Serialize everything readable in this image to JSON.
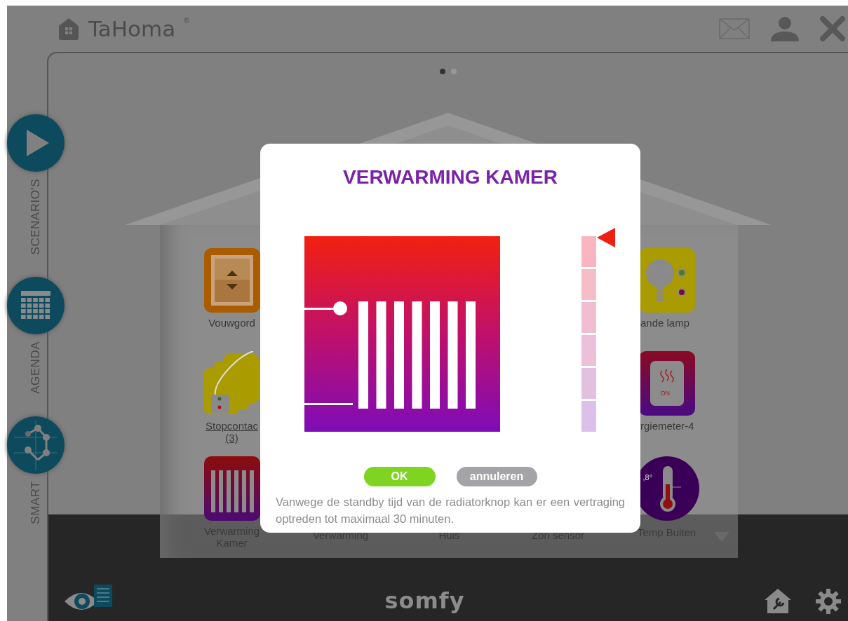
{
  "header": {
    "logo": "TaHoma",
    "logo_mark": "®"
  },
  "rail": [
    {
      "label": "SCENARIO'S",
      "kind": "scenarios"
    },
    {
      "label": "AGENDA",
      "kind": "agenda"
    },
    {
      "label": "SMART",
      "kind": "smart"
    }
  ],
  "pager": [
    {
      "selected": true
    },
    {
      "selected": false
    }
  ],
  "devices": [
    {
      "label": "Vouwgord",
      "kind": "blind",
      "underlined": false
    },
    {
      "label": "ande lamp",
      "kind": "lamp",
      "underlined": false
    },
    {
      "label": "Stopcontac\n(3)",
      "kind": "sockets",
      "underlined": true
    },
    {
      "label": "rgiemeter-4",
      "kind": "meter",
      "badge": "ON",
      "underlined": false
    },
    {
      "label": "Verwarming\nKamer",
      "kind": "radiator",
      "underlined": false
    },
    {
      "label": "Verwarming",
      "kind": "hidden_icon",
      "underlined": false
    },
    {
      "label": "Huis",
      "kind": "hidden_icon",
      "underlined": false
    },
    {
      "label": "Zon sensor",
      "kind": "hidden_icon",
      "underlined": false
    },
    {
      "label": "Temp Buiten",
      "kind": "thermometer",
      "reading": ",8°",
      "underlined": false
    }
  ],
  "dialog": {
    "title": "VERWARMING KAMER",
    "level": 1,
    "buttons": [
      {
        "label": "OK",
        "kind": "primary"
      },
      {
        "label": "annuleren",
        "kind": "secondary"
      }
    ],
    "note": "Vanwege de standby tijd van de radiatorknop kan er een vertraging optreden tot maximaal 30 minuten."
  },
  "footer": {
    "brand": "somfy"
  }
}
